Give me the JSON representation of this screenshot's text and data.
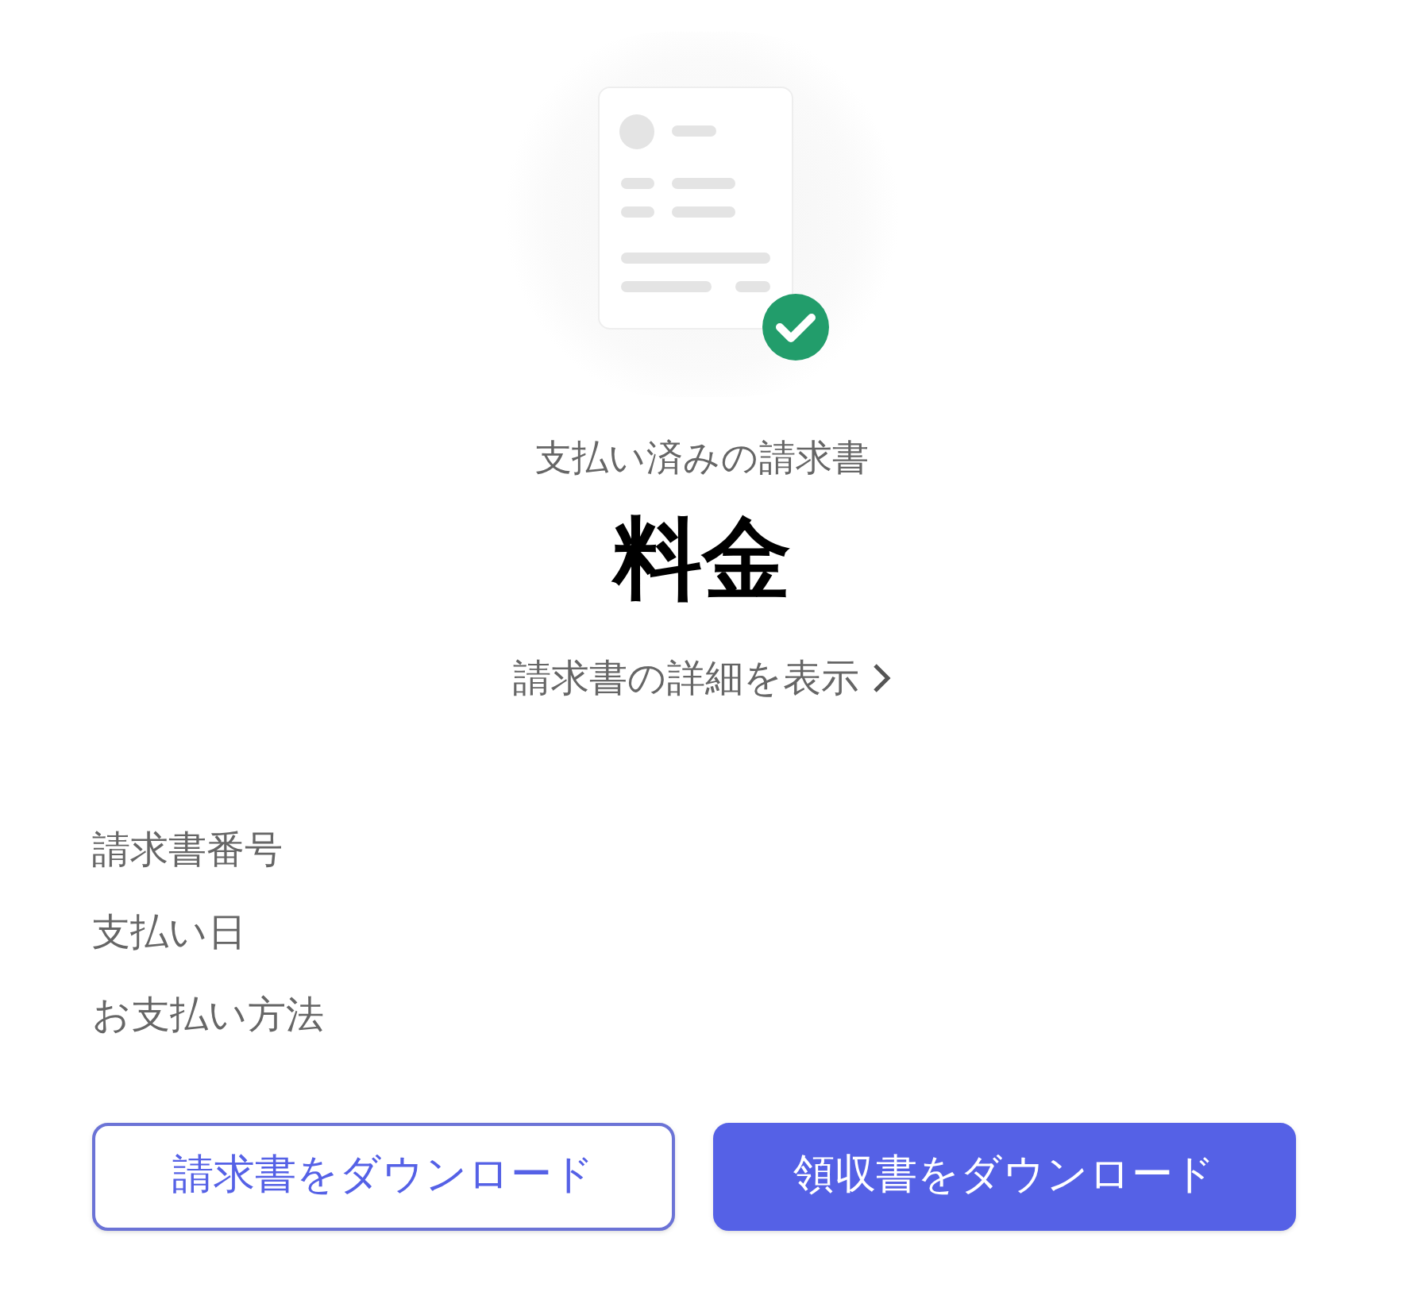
{
  "status": "支払い済みの請求書",
  "amount_label": "料金",
  "details_link": "請求書の詳細を表示",
  "fields": [
    {
      "label": "請求書番号"
    },
    {
      "label": "支払い日"
    },
    {
      "label": "お支払い方法"
    }
  ],
  "buttons": [
    {
      "label": "請求書をダウンロード",
      "kind": "outline"
    },
    {
      "label": "領収書をダウンロード",
      "kind": "primary"
    }
  ]
}
